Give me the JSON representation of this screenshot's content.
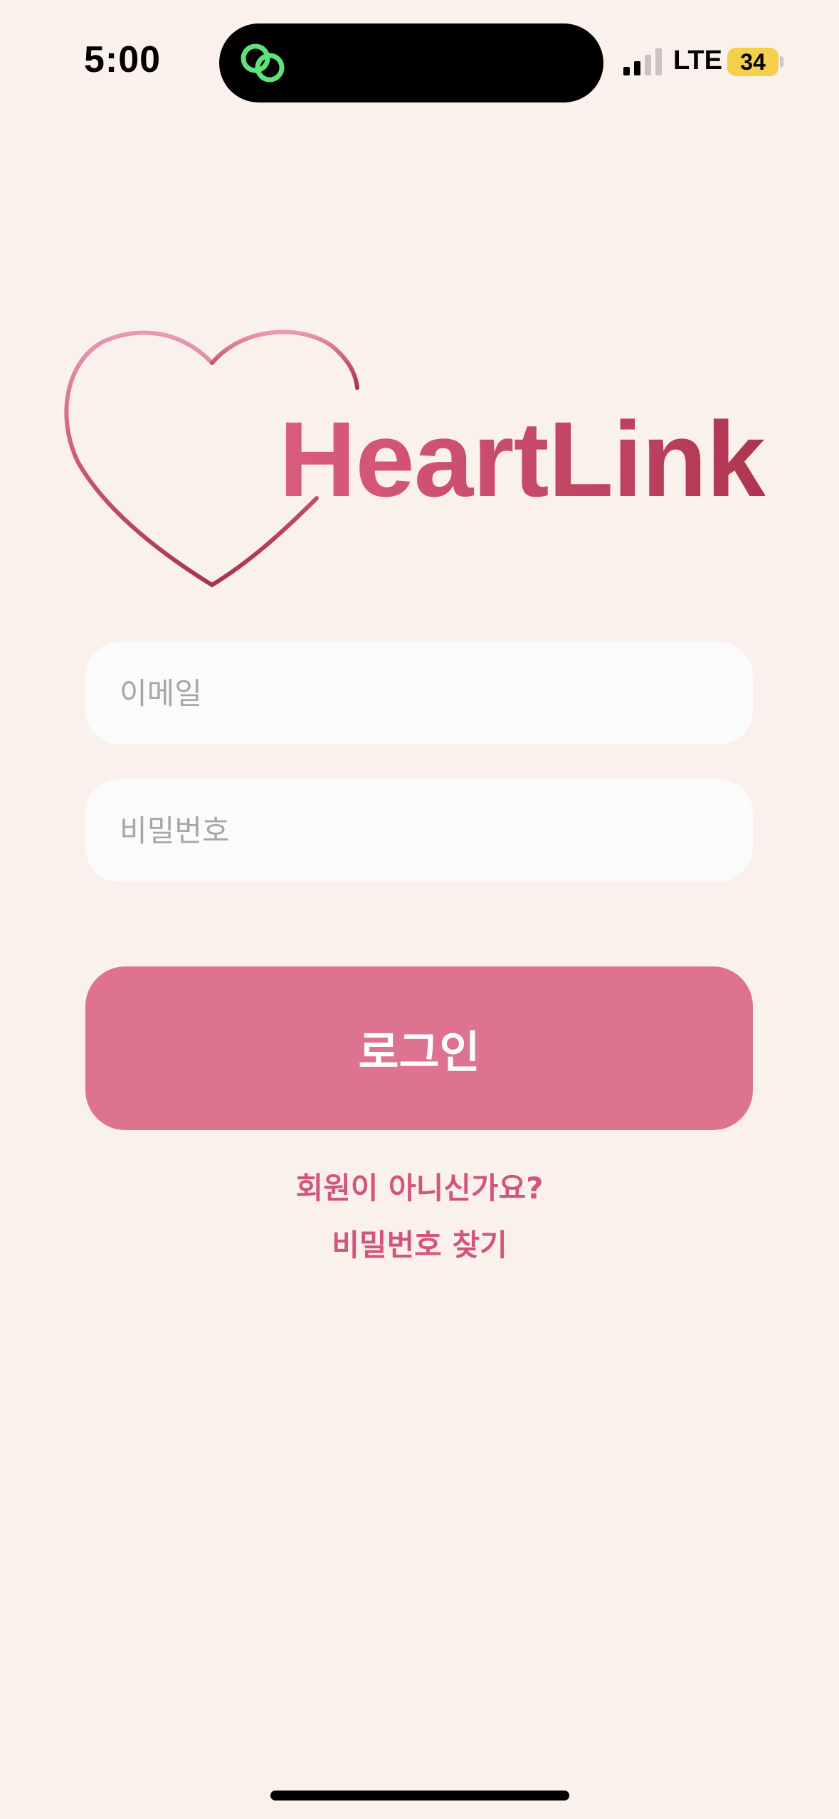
{
  "status_bar": {
    "time": "5:00",
    "network": "LTE",
    "battery": "34",
    "island_icon": "link-rings-icon",
    "signal_icon": "cellular-signal-icon"
  },
  "logo": {
    "text": "HeartLink",
    "icon": "heart-outline-icon"
  },
  "form": {
    "email_placeholder": "이메일",
    "email_value": "",
    "password_placeholder": "비밀번호",
    "password_value": ""
  },
  "login_button": {
    "label": "로그인"
  },
  "links": {
    "signup": "회원이 아니신가요?",
    "find_password": "비밀번호 찾기"
  },
  "colors": {
    "background": "#FAF1EC",
    "accent": "#DD738F",
    "link": "#D0577A",
    "battery": "#F5CF4C",
    "island_icon": "#5FE27A"
  }
}
